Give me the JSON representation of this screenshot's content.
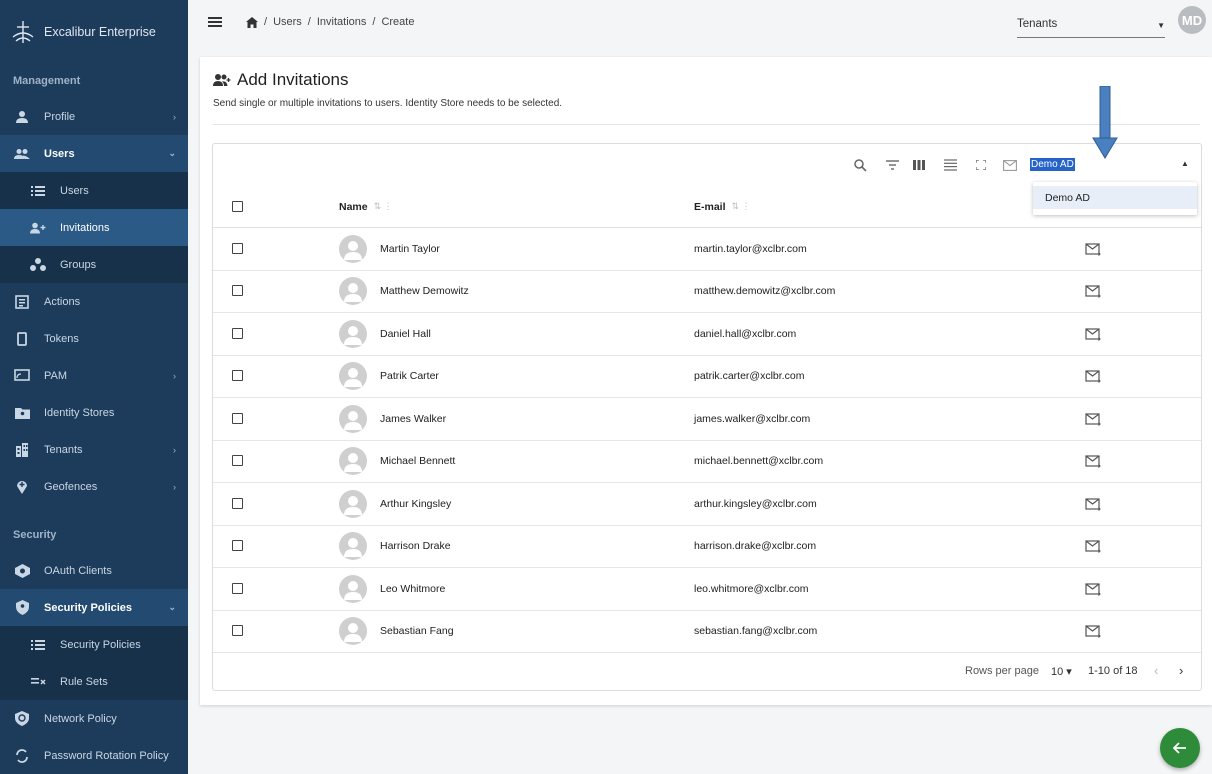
{
  "app": {
    "name": "Excalibur Enterprise"
  },
  "sidebar": {
    "sections": [
      {
        "title": "Management"
      },
      {
        "title": "Security"
      }
    ],
    "management": [
      {
        "label": "Profile",
        "icon": "person-icon",
        "chevron": "›"
      },
      {
        "label": "Users",
        "icon": "people-icon",
        "chevron": "⌄"
      },
      {
        "label": "Users",
        "icon": "list-icon"
      },
      {
        "label": "Invitations",
        "icon": "person-add-icon"
      },
      {
        "label": "Groups",
        "icon": "groups-icon"
      },
      {
        "label": "Actions",
        "icon": "actions-icon"
      },
      {
        "label": "Tokens",
        "icon": "token-icon"
      },
      {
        "label": "PAM",
        "icon": "pam-icon",
        "chevron": "›"
      },
      {
        "label": "Identity Stores",
        "icon": "identity-store-icon"
      },
      {
        "label": "Tenants",
        "icon": "tenant-icon",
        "chevron": "›"
      },
      {
        "label": "Geofences",
        "icon": "geofence-icon",
        "chevron": "›"
      }
    ],
    "security": [
      {
        "label": "OAuth Clients",
        "icon": "oauth-icon"
      },
      {
        "label": "Security Policies",
        "icon": "shield-icon",
        "chevron": "⌄"
      },
      {
        "label": "Security Policies",
        "icon": "list-icon"
      },
      {
        "label": "Rule Sets",
        "icon": "rule-set-icon"
      },
      {
        "label": "Network Policy",
        "icon": "network-icon"
      },
      {
        "label": "Password Rotation Policy",
        "icon": "rotation-icon"
      }
    ]
  },
  "topbar": {
    "breadcrumb": [
      "Users",
      "Invitations",
      "Create"
    ],
    "separator": "/",
    "tenant_select": "Tenants",
    "avatar_initials": "MD"
  },
  "page": {
    "title": "Add Invitations",
    "subtitle": "Send single or multiple invitations to users. Identity Store needs to be selected."
  },
  "table": {
    "identity_store_selected": "Demo AD",
    "dropdown_options": [
      "Demo AD"
    ],
    "columns": {
      "name": "Name",
      "email": "E-mail"
    },
    "rows": [
      {
        "name": "Martin Taylor",
        "email": "martin.taylor@xclbr.com"
      },
      {
        "name": "Matthew Demowitz",
        "email": "matthew.demowitz@xclbr.com"
      },
      {
        "name": "Daniel Hall",
        "email": "daniel.hall@xclbr.com"
      },
      {
        "name": "Patrik Carter",
        "email": "patrik.carter@xclbr.com"
      },
      {
        "name": "James Walker",
        "email": "james.walker@xclbr.com"
      },
      {
        "name": "Michael Bennett",
        "email": "michael.bennett@xclbr.com"
      },
      {
        "name": "Arthur Kingsley",
        "email": "arthur.kingsley@xclbr.com"
      },
      {
        "name": "Harrison Drake",
        "email": "harrison.drake@xclbr.com"
      },
      {
        "name": "Leo Whitmore",
        "email": "leo.whitmore@xclbr.com"
      },
      {
        "name": "Sebastian Fang",
        "email": "sebastian.fang@xclbr.com"
      }
    ],
    "footer": {
      "rows_per_page_label": "Rows per page",
      "rows_per_page": "10",
      "range": "1-10 of 18"
    }
  },
  "colors": {
    "sidebar": "#1d3c5c",
    "accent": "#2563c9",
    "fab": "#2e8b3a"
  }
}
